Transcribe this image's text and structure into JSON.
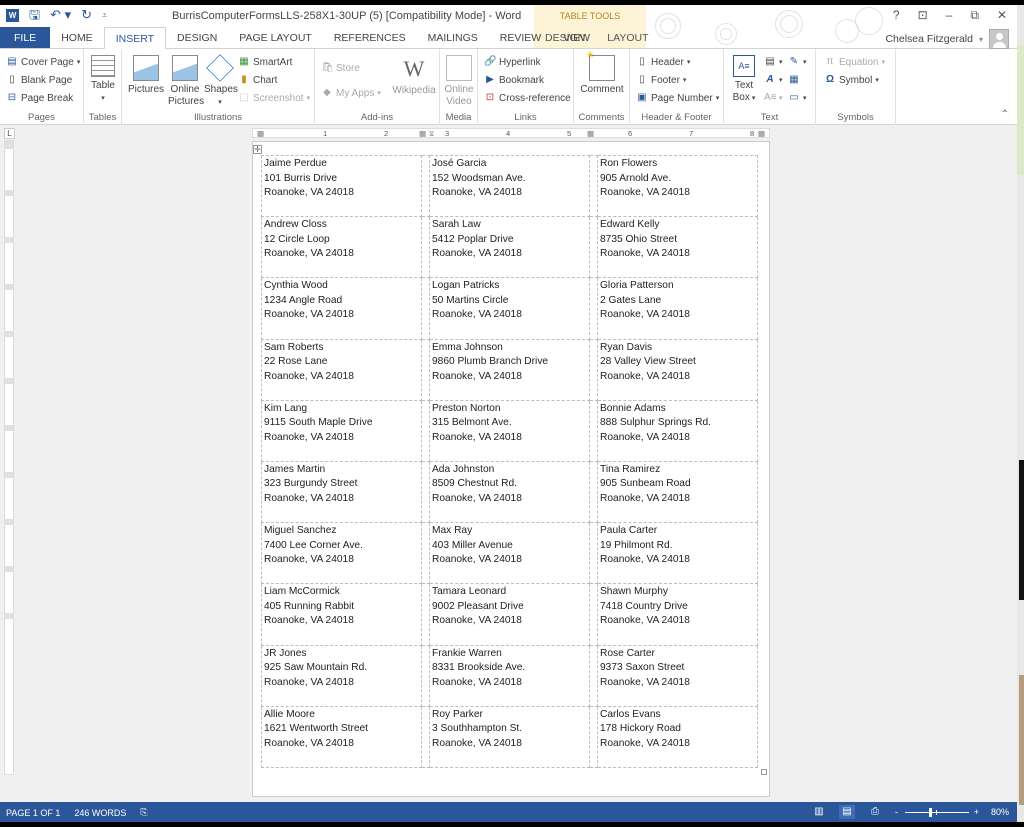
{
  "window": {
    "title": "BurrisComputerFormsLLS-258X1-30UP (5) [Compatibility Mode] - Word",
    "controls": {
      "help": "?",
      "ribbon_display": "⊡",
      "minimize": "–",
      "restore": "⧉",
      "close": "✕"
    }
  },
  "quick_access": {
    "undo": "↶ ▾",
    "redo": "↻",
    "customize": "⩡"
  },
  "tabs": [
    {
      "label": "FILE"
    },
    {
      "label": "HOME"
    },
    {
      "label": "INSERT"
    },
    {
      "label": "DESIGN"
    },
    {
      "label": "PAGE LAYOUT"
    },
    {
      "label": "REFERENCES"
    },
    {
      "label": "MAILINGS"
    },
    {
      "label": "REVIEW"
    },
    {
      "label": "VIEW"
    }
  ],
  "active_tab": "INSERT",
  "contextual": {
    "label": "TABLE TOOLS",
    "tabs": [
      {
        "label": "DESIGN"
      },
      {
        "label": "LAYOUT"
      }
    ],
    "color": "#b3861d"
  },
  "user": {
    "name": "Chelsea Fitzgerald"
  },
  "ribbon": {
    "pages": {
      "label": "Pages",
      "cover_page": "Cover Page",
      "blank_page": "Blank Page",
      "page_break": "Page Break"
    },
    "tables": {
      "label": "Tables",
      "table": "Table"
    },
    "illustrations": {
      "label": "Illustrations",
      "pictures": "Pictures",
      "online_pictures_1": "Online",
      "online_pictures_2": "Pictures",
      "shapes": "Shapes",
      "smartart": "SmartArt",
      "chart": "Chart",
      "screenshot": "Screenshot"
    },
    "addins": {
      "label": "Add-ins",
      "store": "Store",
      "my_apps": "My Apps",
      "wikipedia": "Wikipedia"
    },
    "media": {
      "label": "Media",
      "online_video_1": "Online",
      "online_video_2": "Video"
    },
    "links": {
      "label": "Links",
      "hyperlink": "Hyperlink",
      "bookmark": "Bookmark",
      "cross_reference": "Cross-reference"
    },
    "comments": {
      "label": "Comments",
      "comment": "Comment"
    },
    "header_footer": {
      "label": "Header & Footer",
      "header": "Header",
      "footer": "Footer",
      "page_number": "Page Number"
    },
    "text": {
      "label": "Text",
      "text_box_1": "Text",
      "text_box_2": "Box"
    },
    "symbols": {
      "label": "Symbols",
      "equation": "Equation",
      "symbol": "Symbol"
    }
  },
  "ruler": {
    "marks": [
      "1",
      "2",
      "3",
      "4",
      "5",
      "6",
      "7",
      "8"
    ]
  },
  "labels": [
    [
      "Jaime Perdue",
      "101 Burris Drive",
      "Roanoke, VA 24018"
    ],
    [
      "José Garcia",
      "152 Woodsman Ave.",
      "Roanoke, VA 24018"
    ],
    [
      "Ron Flowers",
      "905 Arnold Ave.",
      "Roanoke, VA 24018"
    ],
    [
      "Andrew Closs",
      "12 Circle Loop",
      "Roanoke, VA 24018"
    ],
    [
      "Sarah Law",
      "5412 Poplar Drive",
      "Roanoke, VA 24018"
    ],
    [
      "Edward Kelly",
      "8735 Ohio Street",
      "Roanoke, VA 24018"
    ],
    [
      "Cynthia Wood",
      "1234 Angle Road",
      "Roanoke, VA 24018"
    ],
    [
      "Logan Patricks",
      "50 Martins Circle",
      "Roanoke, VA 24018"
    ],
    [
      "Gloria Patterson",
      "2 Gates Lane",
      "Roanoke, VA 24018"
    ],
    [
      "Sam Roberts",
      "22 Rose Lane",
      "Roanoke, VA 24018"
    ],
    [
      "Emma Johnson",
      "9860 Plumb Branch Drive",
      "Roanoke, VA 24018"
    ],
    [
      "Ryan Davis",
      "28 Valley View Street",
      "Roanoke, VA 24018"
    ],
    [
      "Kim Lang",
      "9115 South Maple Drive",
      "Roanoke, VA 24018"
    ],
    [
      "Preston Norton",
      "315 Belmont Ave.",
      "Roanoke, VA 24018"
    ],
    [
      "Bonnie Adams",
      "888 Sulphur Springs Rd.",
      "Roanoke, VA 24018"
    ],
    [
      "James Martin",
      "323 Burgundy Street",
      "Roanoke, VA 24018"
    ],
    [
      "Ada Johnston",
      "8509 Chestnut Rd.",
      "Roanoke, VA 24018"
    ],
    [
      "Tina Ramirez",
      "905 Sunbeam Road",
      "Roanoke, VA 24018"
    ],
    [
      "Miguel Sanchez",
      "7400 Lee Corner Ave.",
      "Roanoke, VA 24018"
    ],
    [
      "Max Ray",
      "403 Miller Avenue",
      "Roanoke, VA 24018"
    ],
    [
      "Paula Carter",
      "19 Philmont Rd.",
      "Roanoke, VA 24018"
    ],
    [
      "Liam McCormick",
      "405 Running Rabbit",
      "Roanoke, VA 24018"
    ],
    [
      "Tamara Leonard",
      "9002 Pleasant Drive",
      "Roanoke, VA 24018"
    ],
    [
      "Shawn Murphy",
      "7418 Country Drive",
      "Roanoke, VA 24018"
    ],
    [
      "JR Jones",
      "925 Saw Mountain Rd.",
      "Roanoke, VA 24018"
    ],
    [
      "Frankie Warren",
      "8331 Brookside Ave.",
      "Roanoke, VA 24018"
    ],
    [
      "Rose Carter",
      "9373 Saxon Street",
      "Roanoke, VA 24018"
    ],
    [
      "Allie Moore",
      "1621 Wentworth Street",
      "Roanoke, VA 24018"
    ],
    [
      "Roy Parker",
      "3 Southhampton St.",
      "Roanoke, VA 24018"
    ],
    [
      "Carlos Evans",
      "178 Hickory Road",
      "Roanoke, VA 24018"
    ]
  ],
  "status": {
    "page": "PAGE 1 OF 1",
    "words": "246 WORDS",
    "zoom": "80%",
    "zoom_percent": 80
  },
  "colors": {
    "accent": "#2b579a",
    "context_tab_bg": "#fdf3d6"
  }
}
